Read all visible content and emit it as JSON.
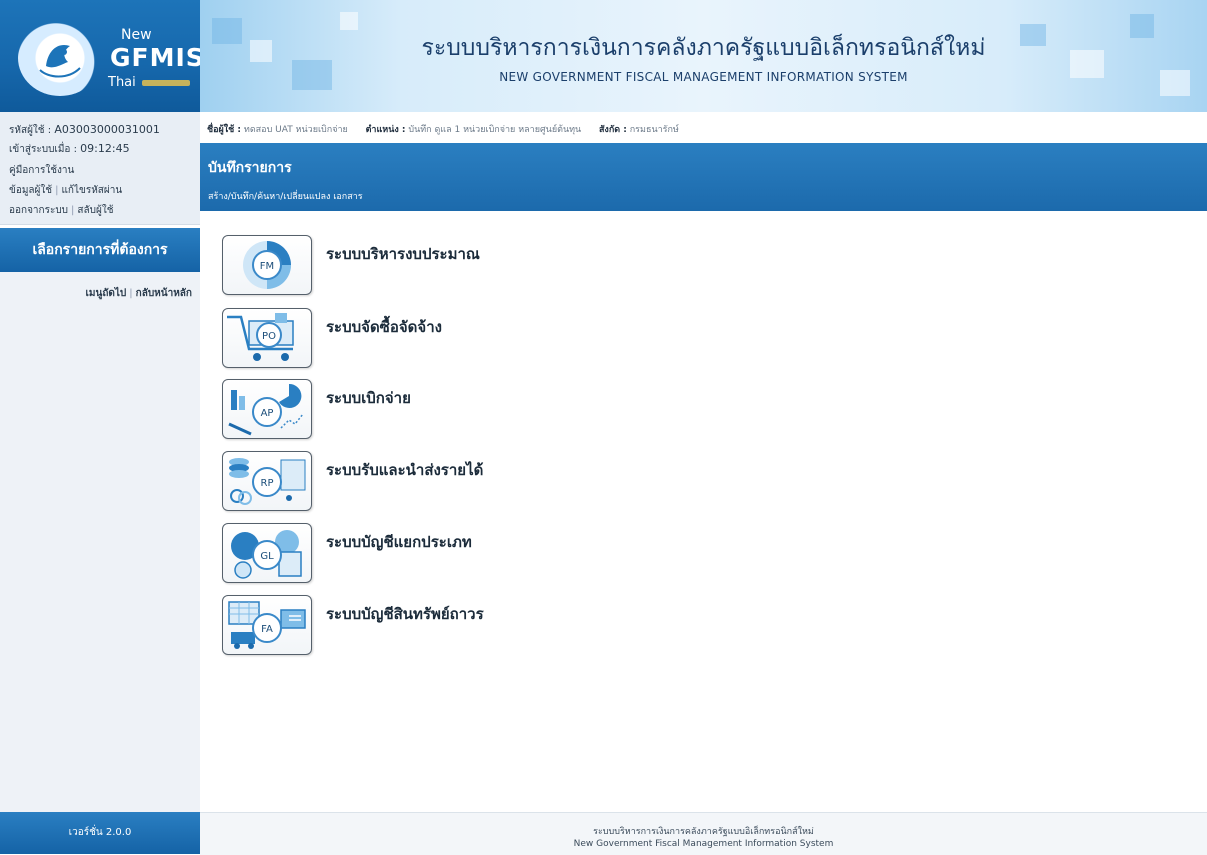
{
  "logo": {
    "new": "New",
    "gfmis": "GFMIS",
    "thai": "Thai"
  },
  "header": {
    "title": "ระบบบริหารการเงินการคลังภาครัฐแบบอิเล็กทรอนิกส์ใหม่",
    "subtitle": "NEW GOVERNMENT FISCAL MANAGEMENT INFORMATION SYSTEM"
  },
  "user_panel": {
    "user_id_label": "รหัสผู้ใช้ :",
    "user_id": "A03003000031001",
    "login_label": "เข้าสู่ระบบเมื่อ :",
    "login_time": "09:12:45",
    "manual": "คู่มือการใช้งาน",
    "user_info": "ข้อมูลผู้ใช้",
    "change_password": "แก้ไขรหัสผ่าน",
    "logout": "ออกจากระบบ",
    "switch_user": "สลับผู้ใช้"
  },
  "sidebar": {
    "menu_header": "เลือกรายการที่ต้องการ",
    "next_menu": "เมนูถัดไป",
    "home": "กลับหน้าหลัก",
    "version": "เวอร์ชั่น 2.0.0"
  },
  "info_line": {
    "name_label": "ชื่อผู้ใช้ :",
    "name": "ทดสอบ UAT หน่วยเบิกจ่าย",
    "position_label": "ตำแหน่ง :",
    "position": "บันทึก ดูแล 1 หน่วยเบิกจ่าย หลายศูนย์ต้นทุน",
    "affiliation_label": "สังกัด :",
    "affiliation": "กรมธนารักษ์"
  },
  "section": {
    "title": "บันทึกรายการ",
    "subtitle": "สร้าง/บันทึก/ค้นหา/เปลี่ยนแปลง เอกสาร"
  },
  "modules": [
    {
      "code": "FM",
      "label": "ระบบบริหารงบประมาณ",
      "icon": "fm-budget-icon"
    },
    {
      "code": "PO",
      "label": "ระบบจัดซื้อจัดจ้าง",
      "icon": "po-cart-icon"
    },
    {
      "code": "AP",
      "label": "ระบบเบิกจ่าย",
      "icon": "ap-chart-icon"
    },
    {
      "code": "RP",
      "label": "ระบบรับและนำส่งรายได้",
      "icon": "rp-coins-icon"
    },
    {
      "code": "GL",
      "label": "ระบบบัญชีแยกประเภท",
      "icon": "gl-ledger-icon"
    },
    {
      "code": "FA",
      "label": "ระบบบัญชีสินทรัพย์ถาวร",
      "icon": "fa-asset-icon"
    }
  ],
  "footer": {
    "line1": "ระบบบริหารการเงินการคลังภาครัฐแบบอิเล็กทรอนิกส์ใหม่",
    "line2": "New Government Fiscal Management Information System"
  },
  "colors": {
    "primary": "#1c6aac",
    "panel": "#e8eef5",
    "accent": "#3a89c9"
  }
}
